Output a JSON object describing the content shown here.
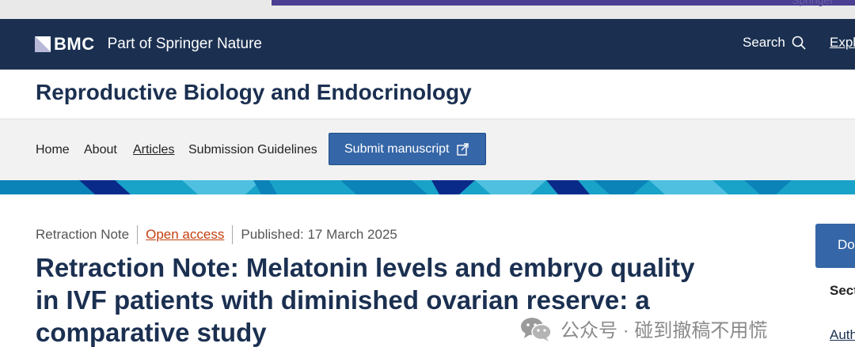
{
  "top_strip": {
    "springer_peek": "Springer"
  },
  "header": {
    "logo_text": "BMC",
    "logo_sub": "Part of Springer Nature",
    "search_label": "Search",
    "explore_label": "Explo"
  },
  "journal": {
    "title": "Reproductive Biology and Endocrinology"
  },
  "nav": {
    "items": [
      {
        "label": "Home"
      },
      {
        "label": "About"
      },
      {
        "label": "Articles"
      },
      {
        "label": "Submission Guidelines"
      }
    ],
    "submit_label": "Submit manuscript"
  },
  "article": {
    "type": "Retraction Note",
    "access": "Open access",
    "published": "Published: 17 March 2025",
    "title": "Retraction Note: Melatonin levels and embryo quality in IVF patients with diminished ovarian reserve: a comparative study"
  },
  "sidebar": {
    "button_label": "Do",
    "section_label": "Sect",
    "authors_label": "Auth"
  },
  "watermark": {
    "text": "公众号 · 碰到撤稿不用慌"
  },
  "colors": {
    "header_bg": "#1b3051",
    "accent_blue": "#3566a7",
    "open_access": "#c4400f",
    "pattern_cyan": "#1aa3c9"
  }
}
